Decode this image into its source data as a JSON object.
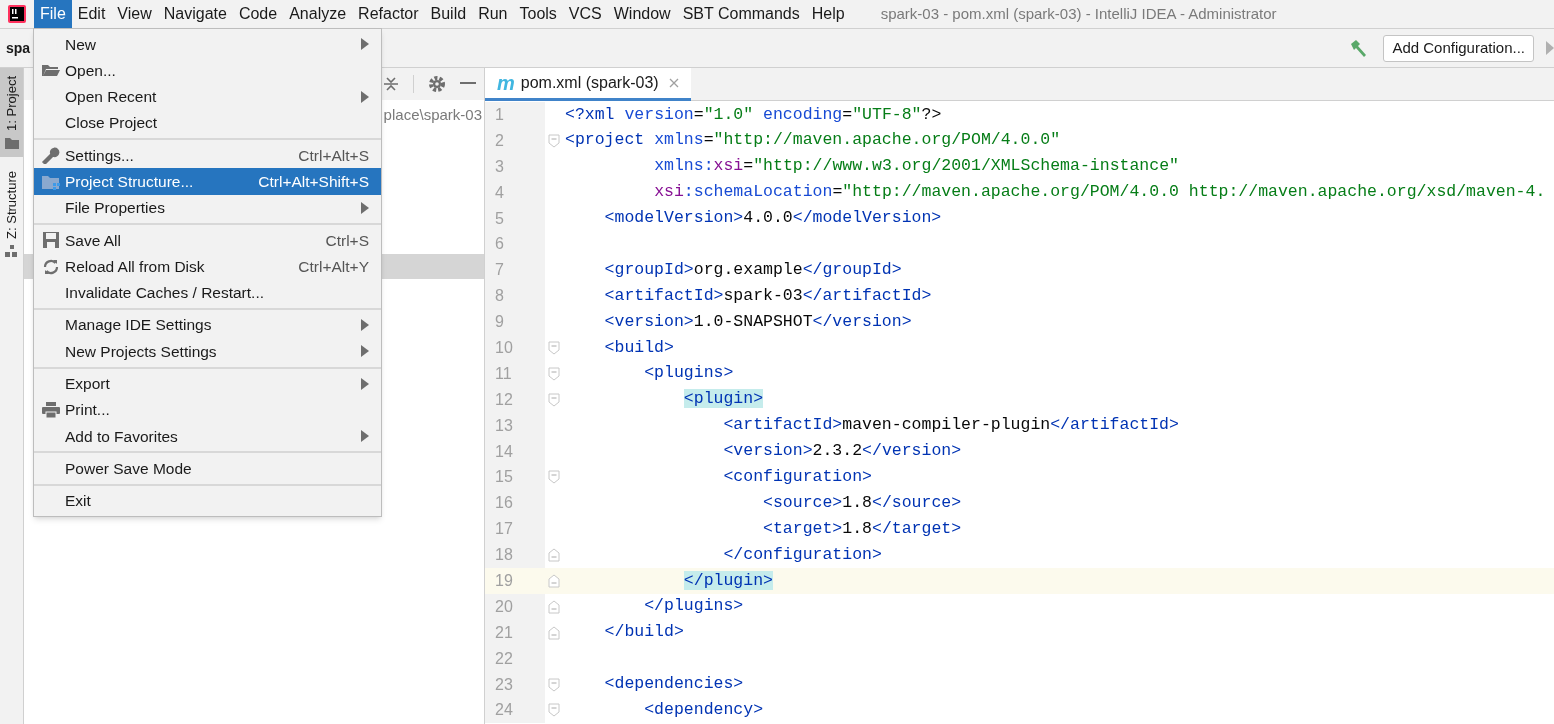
{
  "menubar": {
    "items": [
      {
        "label": "File",
        "selected": true
      },
      {
        "label": "Edit",
        "selected": false
      },
      {
        "label": "View",
        "selected": false
      },
      {
        "label": "Navigate",
        "selected": false
      },
      {
        "label": "Code",
        "selected": false
      },
      {
        "label": "Analyze",
        "selected": false
      },
      {
        "label": "Refactor",
        "selected": false
      },
      {
        "label": "Build",
        "selected": false
      },
      {
        "label": "Run",
        "selected": false
      },
      {
        "label": "Tools",
        "selected": false
      },
      {
        "label": "VCS",
        "selected": false
      },
      {
        "label": "Window",
        "selected": false
      },
      {
        "label": "SBT Commands",
        "selected": false
      },
      {
        "label": "Help",
        "selected": false
      }
    ],
    "title": "spark-03 - pom.xml (spark-03) - IntelliJ IDEA - Administrator"
  },
  "toolbar": {
    "project_name": "spa",
    "run_config": "Add Configuration..."
  },
  "tool_windows": [
    {
      "label": "1: Project",
      "selected": true,
      "kind": "folder"
    },
    {
      "label": "Z: Structure",
      "selected": false,
      "kind": "structure"
    }
  ],
  "project_panel": {
    "path": "place\\spark-03"
  },
  "file_menu": {
    "items": [
      {
        "label": "New",
        "submenu": true,
        "selected": false,
        "separator_before": false
      },
      {
        "label": "Open...",
        "kind": "folder",
        "selected": false,
        "separator_before": false
      },
      {
        "label": "Open Recent",
        "submenu": true,
        "selected": false,
        "separator_before": false
      },
      {
        "label": "Close Project",
        "selected": false,
        "separator_before": false
      },
      {
        "label": "Settings...",
        "kind": "wrench",
        "shortcut": "Ctrl+Alt+S",
        "selected": false,
        "separator_before": true
      },
      {
        "label": "Project Structure...",
        "kind": "structure",
        "shortcut": "Ctrl+Alt+Shift+S",
        "selected": true,
        "separator_before": false
      },
      {
        "label": "File Properties",
        "submenu": true,
        "selected": false,
        "separator_before": false
      },
      {
        "label": "Save All",
        "kind": "save",
        "shortcut": "Ctrl+S",
        "selected": false,
        "separator_before": true
      },
      {
        "label": "Reload All from Disk",
        "kind": "reload",
        "shortcut": "Ctrl+Alt+Y",
        "selected": false,
        "separator_before": false
      },
      {
        "label": "Invalidate Caches / Restart...",
        "selected": false,
        "separator_before": false
      },
      {
        "label": "Manage IDE Settings",
        "submenu": true,
        "selected": false,
        "separator_before": true
      },
      {
        "label": "New Projects Settings",
        "submenu": true,
        "selected": false,
        "separator_before": false
      },
      {
        "label": "Export",
        "submenu": true,
        "selected": false,
        "separator_before": true
      },
      {
        "label": "Print...",
        "kind": "print",
        "selected": false,
        "separator_before": false
      },
      {
        "label": "Add to Favorites",
        "submenu": true,
        "selected": false,
        "separator_before": false
      },
      {
        "label": "Power Save Mode",
        "selected": false,
        "separator_before": true
      },
      {
        "label": "Exit",
        "selected": false,
        "separator_before": true
      }
    ]
  },
  "editor": {
    "tabs": [
      {
        "label": "pom.xml (spark-03)",
        "badge": "m",
        "selected": true
      }
    ],
    "lines": [
      {
        "number": "1",
        "tokens": [
          {
            "kind": "tag",
            "text": "<?xml "
          },
          {
            "kind": "attr",
            "text": "version"
          },
          {
            "kind": "text",
            "text": "="
          },
          {
            "kind": "value",
            "text": "\"1.0\" "
          },
          {
            "kind": "attr",
            "text": "encoding"
          },
          {
            "kind": "text",
            "text": "="
          },
          {
            "kind": "value",
            "text": "\"UTF-8\""
          },
          {
            "kind": "text",
            "text": "?>"
          }
        ]
      },
      {
        "number": "2",
        "fold_start": true,
        "tokens": [
          {
            "kind": "tag",
            "text": "<project "
          },
          {
            "kind": "attr",
            "text": "xmlns"
          },
          {
            "kind": "text",
            "text": "="
          },
          {
            "kind": "value",
            "text": "\"http://maven.apache.org/POM/4.0.0\""
          }
        ]
      },
      {
        "number": "3",
        "tokens": [
          {
            "kind": "attr",
            "text": "         xmlns:"
          },
          {
            "kind": "ns",
            "text": "xsi"
          },
          {
            "kind": "text",
            "text": "="
          },
          {
            "kind": "value",
            "text": "\"http://www.w3.org/2001/XMLSchema-instance\""
          }
        ]
      },
      {
        "number": "4",
        "tokens": [
          {
            "kind": "ns",
            "text": "         xsi"
          },
          {
            "kind": "attr",
            "text": ":schemaLocation"
          },
          {
            "kind": "text",
            "text": "="
          },
          {
            "kind": "value",
            "text": "\"http://maven.apache.org/POM/4.0.0 http://maven.apache.org/xsd/maven-4."
          }
        ]
      },
      {
        "number": "5",
        "tokens": [
          {
            "kind": "tag",
            "text": "    <modelVersion>"
          },
          {
            "kind": "text",
            "text": "4.0.0"
          },
          {
            "kind": "tag",
            "text": "</modelVersion>"
          }
        ]
      },
      {
        "number": "6"
      },
      {
        "number": "7",
        "tokens": [
          {
            "kind": "tag",
            "text": "    <groupId>"
          },
          {
            "kind": "text",
            "text": "org.example"
          },
          {
            "kind": "tag",
            "text": "</groupId>"
          }
        ]
      },
      {
        "number": "8",
        "tokens": [
          {
            "kind": "tag",
            "text": "    <artifactId>"
          },
          {
            "kind": "text",
            "text": "spark-03"
          },
          {
            "kind": "tag",
            "text": "</artifactId>"
          }
        ]
      },
      {
        "number": "9",
        "tokens": [
          {
            "kind": "tag",
            "text": "    <version>"
          },
          {
            "kind": "text",
            "text": "1.0-SNAPSHOT"
          },
          {
            "kind": "tag",
            "text": "</version>"
          }
        ]
      },
      {
        "number": "10",
        "fold_start": true,
        "tokens": [
          {
            "kind": "tag",
            "text": "    <build>"
          }
        ]
      },
      {
        "number": "11",
        "fold_start": true,
        "tokens": [
          {
            "kind": "tag",
            "text": "        <plugins>"
          }
        ]
      },
      {
        "number": "12",
        "fold_start": true,
        "matched": true,
        "tokens": [
          {
            "kind": "tag",
            "text": "            <plugin>"
          }
        ]
      },
      {
        "number": "13",
        "tokens": [
          {
            "kind": "tag",
            "text": "                <artifactId>"
          },
          {
            "kind": "text",
            "text": "maven-compiler-plugin"
          },
          {
            "kind": "tag",
            "text": "</artifactId>"
          }
        ]
      },
      {
        "number": "14",
        "tokens": [
          {
            "kind": "tag",
            "text": "                <version>"
          },
          {
            "kind": "text",
            "text": "2.3.2"
          },
          {
            "kind": "tag",
            "text": "</version>"
          }
        ]
      },
      {
        "number": "15",
        "fold_start": true,
        "tokens": [
          {
            "kind": "tag",
            "text": "                <configuration>"
          }
        ]
      },
      {
        "number": "16",
        "tokens": [
          {
            "kind": "tag",
            "text": "                    <source>"
          },
          {
            "kind": "text",
            "text": "1.8"
          },
          {
            "kind": "tag",
            "text": "</source>"
          }
        ]
      },
      {
        "number": "17",
        "tokens": [
          {
            "kind": "tag",
            "text": "                    <target>"
          },
          {
            "kind": "text",
            "text": "1.8"
          },
          {
            "kind": "tag",
            "text": "</target>"
          }
        ]
      },
      {
        "number": "18",
        "fold_end": true,
        "tokens": [
          {
            "kind": "tag",
            "text": "                </configuration>"
          }
        ]
      },
      {
        "number": "19",
        "fold_end": true,
        "current": true,
        "matched": true,
        "tokens": [
          {
            "kind": "tag",
            "text": "            </plugin>"
          }
        ]
      },
      {
        "number": "20",
        "fold_end": true,
        "tokens": [
          {
            "kind": "tag",
            "text": "        </plugins>"
          }
        ]
      },
      {
        "number": "21",
        "fold_end": true,
        "tokens": [
          {
            "kind": "tag",
            "text": "    </build>"
          }
        ]
      },
      {
        "number": "22"
      },
      {
        "number": "23",
        "fold_start": true,
        "tokens": [
          {
            "kind": "tag",
            "text": "    <dependencies>"
          }
        ]
      },
      {
        "number": "24",
        "fold_start": true,
        "tokens": [
          {
            "kind": "tag",
            "text": "        <dependency>"
          }
        ]
      }
    ]
  }
}
